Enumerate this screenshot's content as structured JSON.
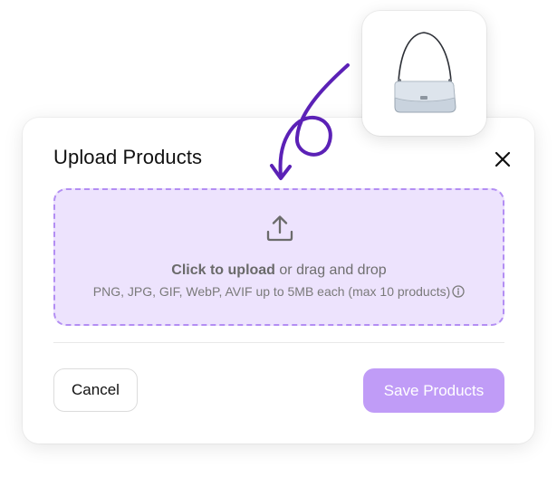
{
  "modal": {
    "title": "Upload Products",
    "close_icon": "close-icon"
  },
  "dropzone": {
    "icon": "upload-icon",
    "action_strong": "Click to upload",
    "action_rest": " or drag and drop",
    "hint": "PNG, JPG, GIF, WebP, AVIF up to 5MB each (max 10 products)",
    "hint_icon": "info-icon"
  },
  "footer": {
    "cancel_label": "Cancel",
    "save_label": "Save Products"
  },
  "product_preview": {
    "icon": "handbag-icon"
  },
  "colors": {
    "accent": "#8b5cf6",
    "dropzone_bg": "#ede3fd",
    "dropzone_border": "#b38ef3",
    "save_bg": "#c09cf7",
    "arrow": "#5b21b6"
  }
}
